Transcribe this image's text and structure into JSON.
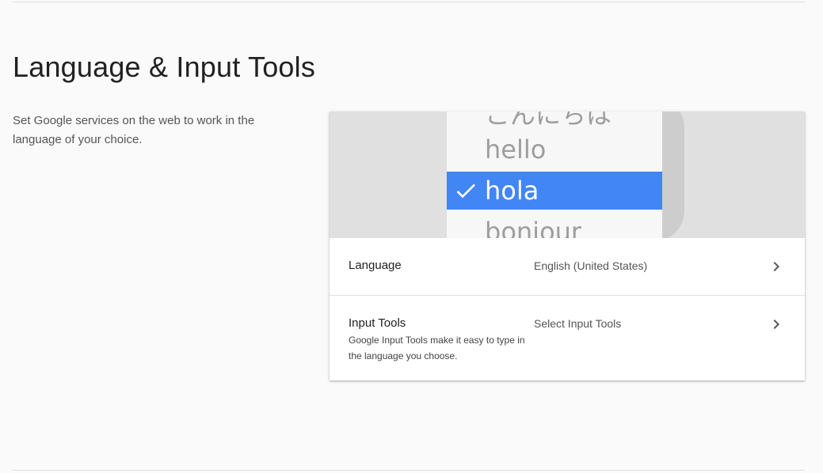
{
  "section": {
    "title": "Language & Input Tools",
    "description": "Set Google services on the web to work in the language of your choice."
  },
  "illustration": {
    "items": [
      "こんにちは",
      "hello",
      "hola",
      "bonjour"
    ],
    "selected": "hola",
    "selected_color": "#4285f4"
  },
  "settings": {
    "language": {
      "label": "Language",
      "value": "English (United States)"
    },
    "input_tools": {
      "label": "Input Tools",
      "description": "Google Input Tools make it easy to type in the language you choose.",
      "value": "Select Input Tools"
    }
  },
  "icons": {
    "check": "check-icon",
    "chevron": "chevron-right-icon"
  }
}
